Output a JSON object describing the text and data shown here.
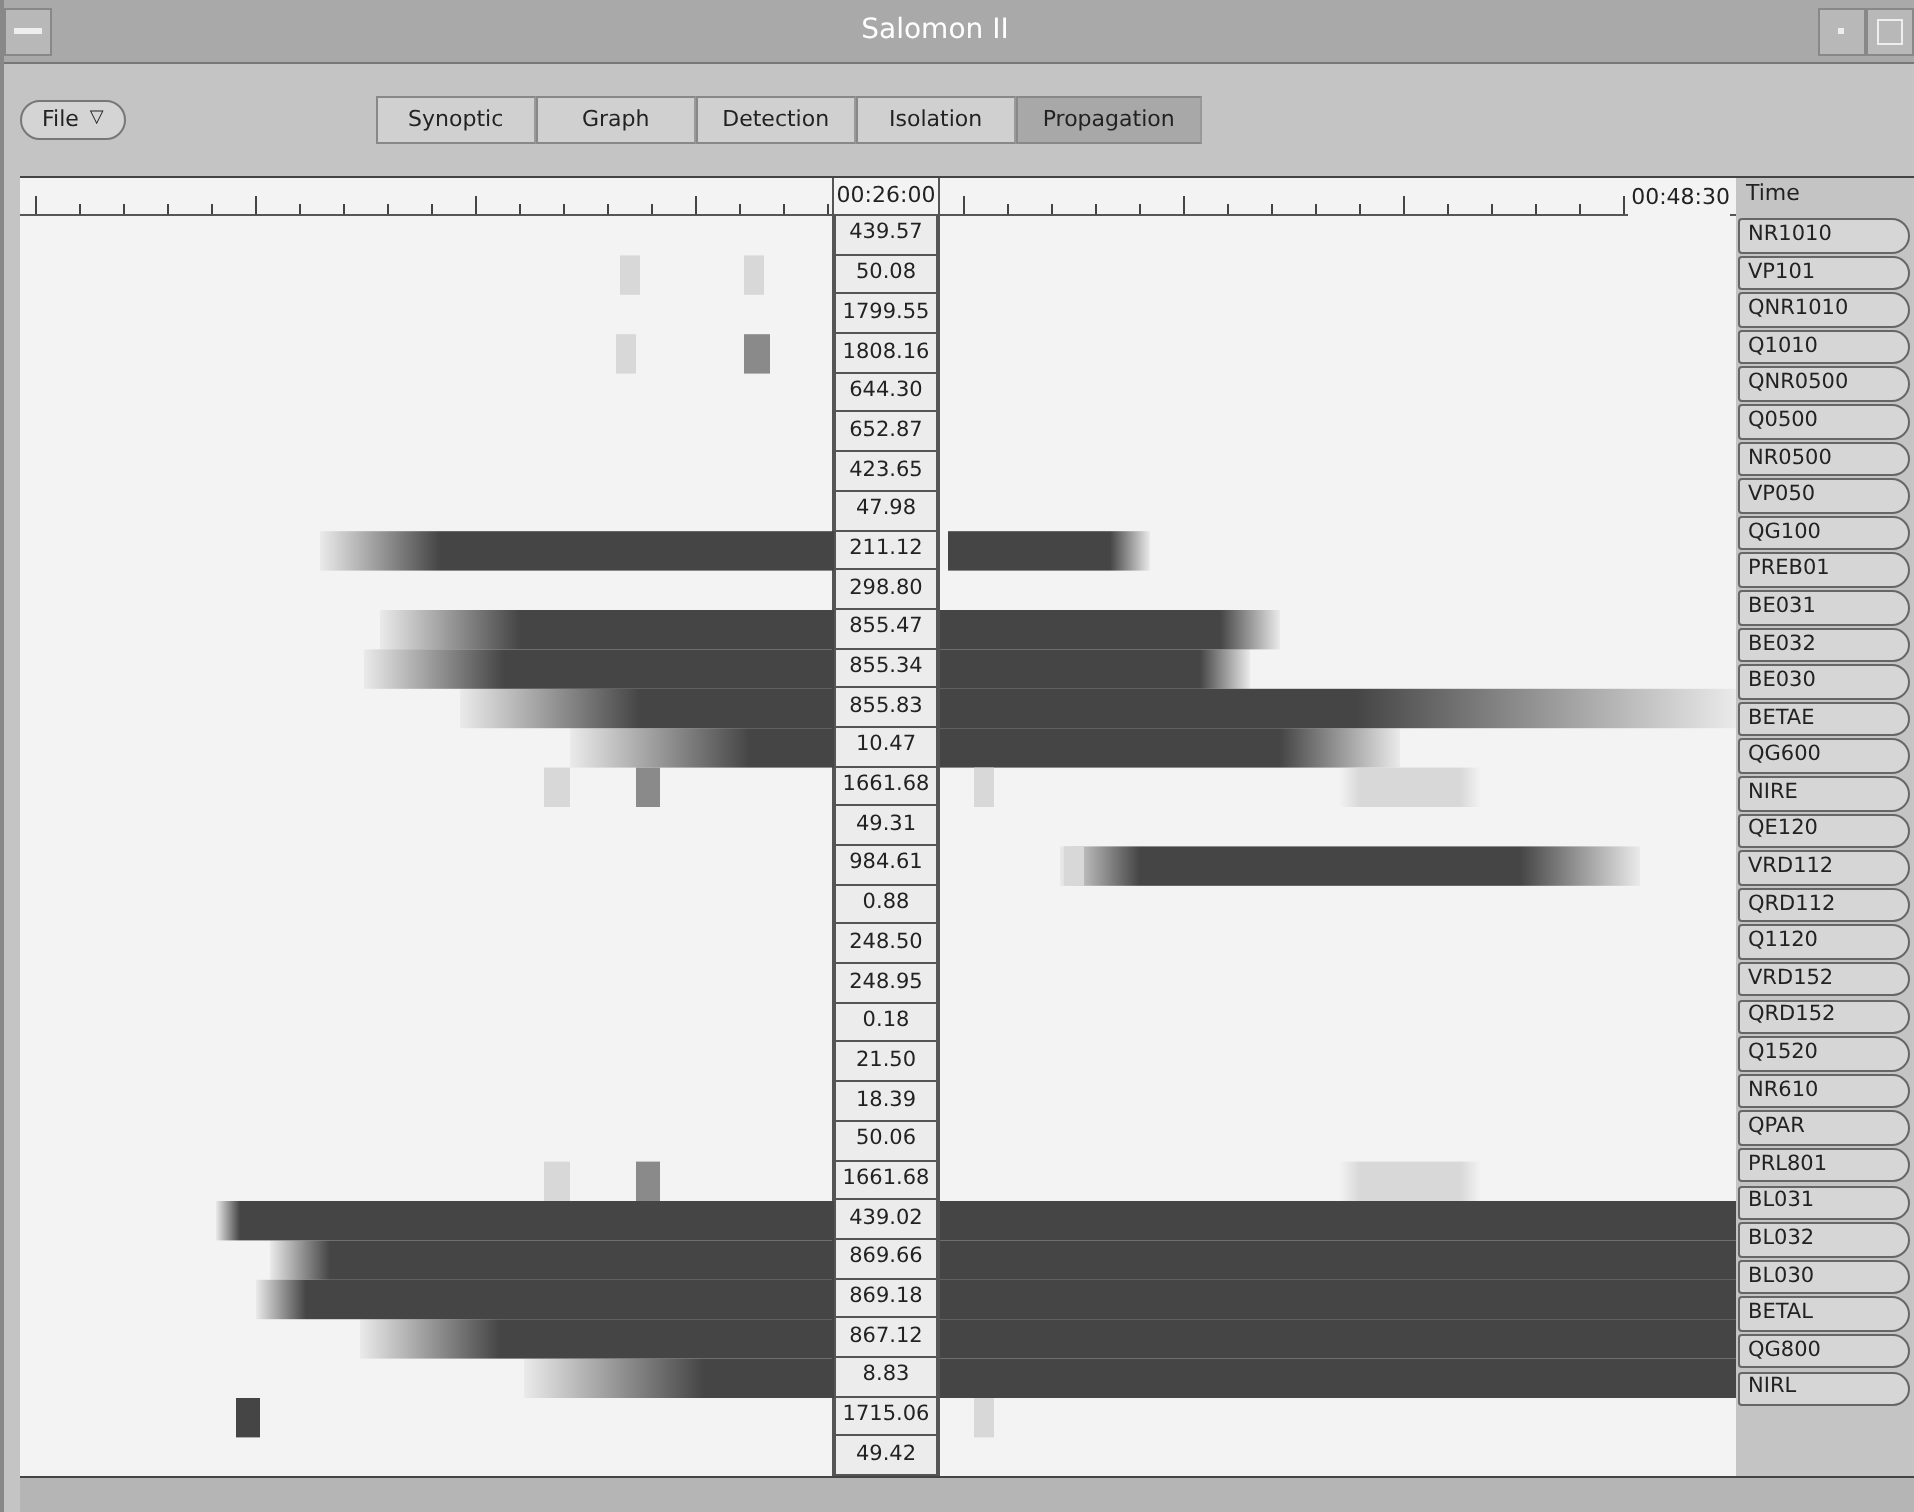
{
  "window": {
    "title": "Salomon II"
  },
  "menu": {
    "label": "File",
    "arrow": "▽"
  },
  "tabs": [
    {
      "label": "Synoptic",
      "selected": false
    },
    {
      "label": "Graph",
      "selected": false
    },
    {
      "label": "Detection",
      "selected": false
    },
    {
      "label": "Isolation",
      "selected": false
    },
    {
      "label": "Propagation",
      "selected": true
    }
  ],
  "ruler": {
    "center_time": "00:26:00",
    "end_time": "00:48:30",
    "column_heading": "Time"
  },
  "rows": [
    {
      "value": "439.57",
      "label": "NR1010"
    },
    {
      "value": "50.08",
      "label": "VP101"
    },
    {
      "value": "1799.55",
      "label": "QNR1010"
    },
    {
      "value": "1808.16",
      "label": "Q1010"
    },
    {
      "value": "644.30",
      "label": "QNR0500"
    },
    {
      "value": "652.87",
      "label": "Q0500"
    },
    {
      "value": "423.65",
      "label": "NR0500"
    },
    {
      "value": "47.98",
      "label": "VP050"
    },
    {
      "value": "211.12",
      "label": "QG100"
    },
    {
      "value": "298.80",
      "label": "PREB01"
    },
    {
      "value": "855.47",
      "label": "BE031"
    },
    {
      "value": "855.34",
      "label": "BE032"
    },
    {
      "value": "855.83",
      "label": "BE030"
    },
    {
      "value": "10.47",
      "label": "BETAE"
    },
    {
      "value": "1661.68",
      "label": "QG600"
    },
    {
      "value": "49.31",
      "label": "NIRE"
    },
    {
      "value": "984.61",
      "label": "QE120"
    },
    {
      "value": "0.88",
      "label": "VRD112"
    },
    {
      "value": "248.50",
      "label": "QRD112"
    },
    {
      "value": "248.95",
      "label": "Q1120"
    },
    {
      "value": "0.18",
      "label": "VRD152"
    },
    {
      "value": "21.50",
      "label": "QRD152"
    },
    {
      "value": "18.39",
      "label": "Q1520"
    },
    {
      "value": "50.06",
      "label": "NR610"
    },
    {
      "value": "1661.68",
      "label": "QPAR"
    },
    {
      "value": "439.02",
      "label": "PRL801"
    },
    {
      "value": "869.66",
      "label": "BL031"
    },
    {
      "value": "869.18",
      "label": "BL032"
    },
    {
      "value": "867.12",
      "label": "BL030"
    },
    {
      "value": "8.83",
      "label": "BETAL"
    },
    {
      "value": "1715.06",
      "label": "QG800"
    },
    {
      "value": "49.42",
      "label": "NIRL"
    }
  ]
}
